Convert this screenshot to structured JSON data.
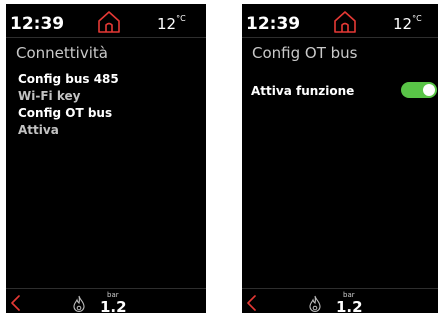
{
  "colors": {
    "background": "#000000",
    "accent_red": "#e53935",
    "toggle_on": "#59c447",
    "text_primary": "#ffffff",
    "text_secondary": "#c3c3c3"
  },
  "screens": [
    {
      "status": {
        "time": "12:39",
        "temperature": "12",
        "temperature_unit": "°C",
        "home_icon": "home-icon"
      },
      "title": "Connettività",
      "menu": [
        {
          "label": "Config bus 485",
          "style": "primary"
        },
        {
          "label": "Wi-Fi key",
          "style": "secondary"
        },
        {
          "label": "Config OT bus",
          "style": "primary"
        },
        {
          "label": "Attiva",
          "style": "secondary"
        }
      ],
      "footer": {
        "back_icon": "chevron-left-icon",
        "flame_icon": "flame-icon",
        "pressure_unit": "bar",
        "pressure_value": "1.2"
      }
    },
    {
      "status": {
        "time": "12:39",
        "temperature": "12",
        "temperature_unit": "°C",
        "home_icon": "home-icon"
      },
      "title": "Config OT bus",
      "setting": {
        "label": "Attiva funzione",
        "enabled": true
      },
      "footer": {
        "back_icon": "chevron-left-icon",
        "flame_icon": "flame-icon",
        "pressure_unit": "bar",
        "pressure_value": "1.2"
      }
    }
  ]
}
